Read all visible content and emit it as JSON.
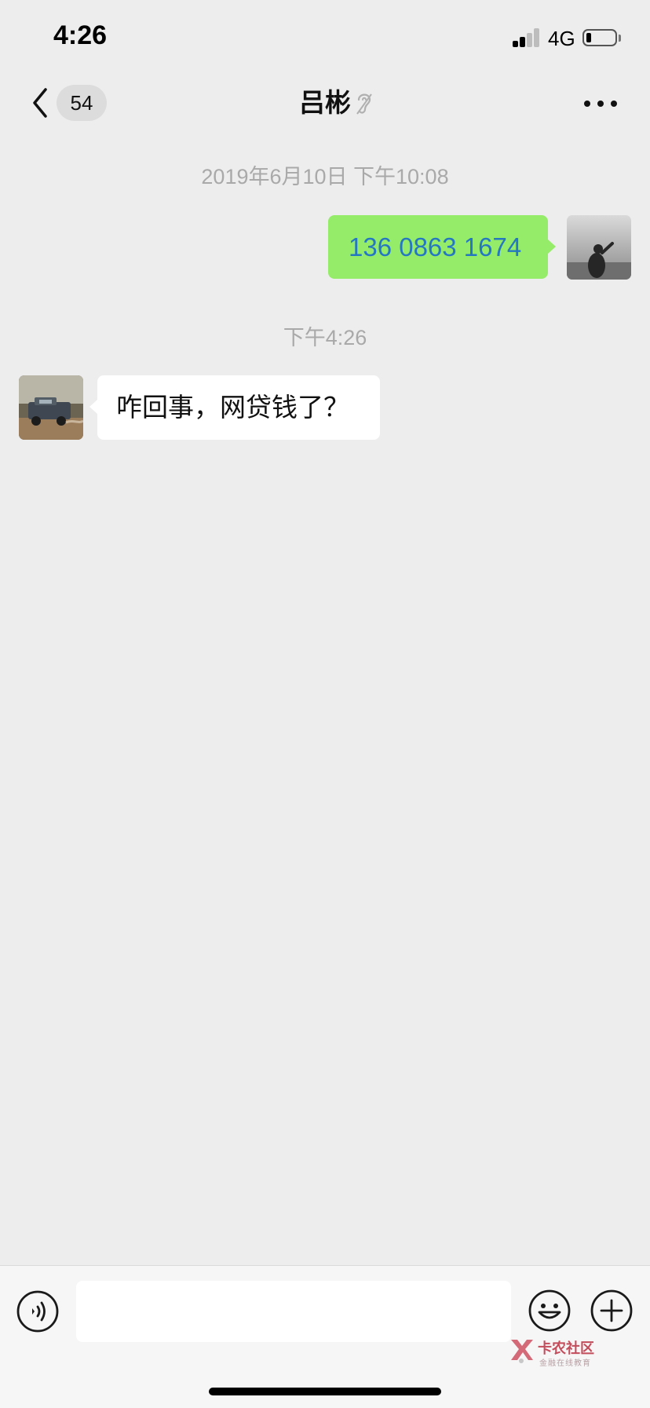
{
  "status_bar": {
    "time": "4:26",
    "network": "4G",
    "signal_level": 2,
    "battery_level": 0.18
  },
  "nav": {
    "unread_count": "54",
    "title": "吕彬",
    "icons": {
      "back": "chevron-left-icon",
      "mute": "ear-muted-icon",
      "more": "more-dots-icon"
    }
  },
  "messages": [
    {
      "type": "timestamp",
      "text": "2019年6月10日 下午10:08"
    },
    {
      "type": "message",
      "sender": "me",
      "text": "136 0863 1674"
    },
    {
      "type": "timestamp",
      "text": "下午4:26"
    },
    {
      "type": "message",
      "sender": "contact",
      "text": "咋回事，网贷钱了？"
    }
  ],
  "input_bar": {
    "input_value": "",
    "icons": {
      "voice": "voice-input-icon",
      "emoji": "emoji-icon",
      "more": "plus-icon"
    }
  },
  "watermark": {
    "title": "卡农社区",
    "subtitle": "金融在线教育"
  },
  "colors": {
    "background": "#ededed",
    "my_bubble": "#95ec69",
    "their_bubble": "#ffffff",
    "link_text": "#2577c2",
    "timestamp_text": "#a9a9a9"
  }
}
